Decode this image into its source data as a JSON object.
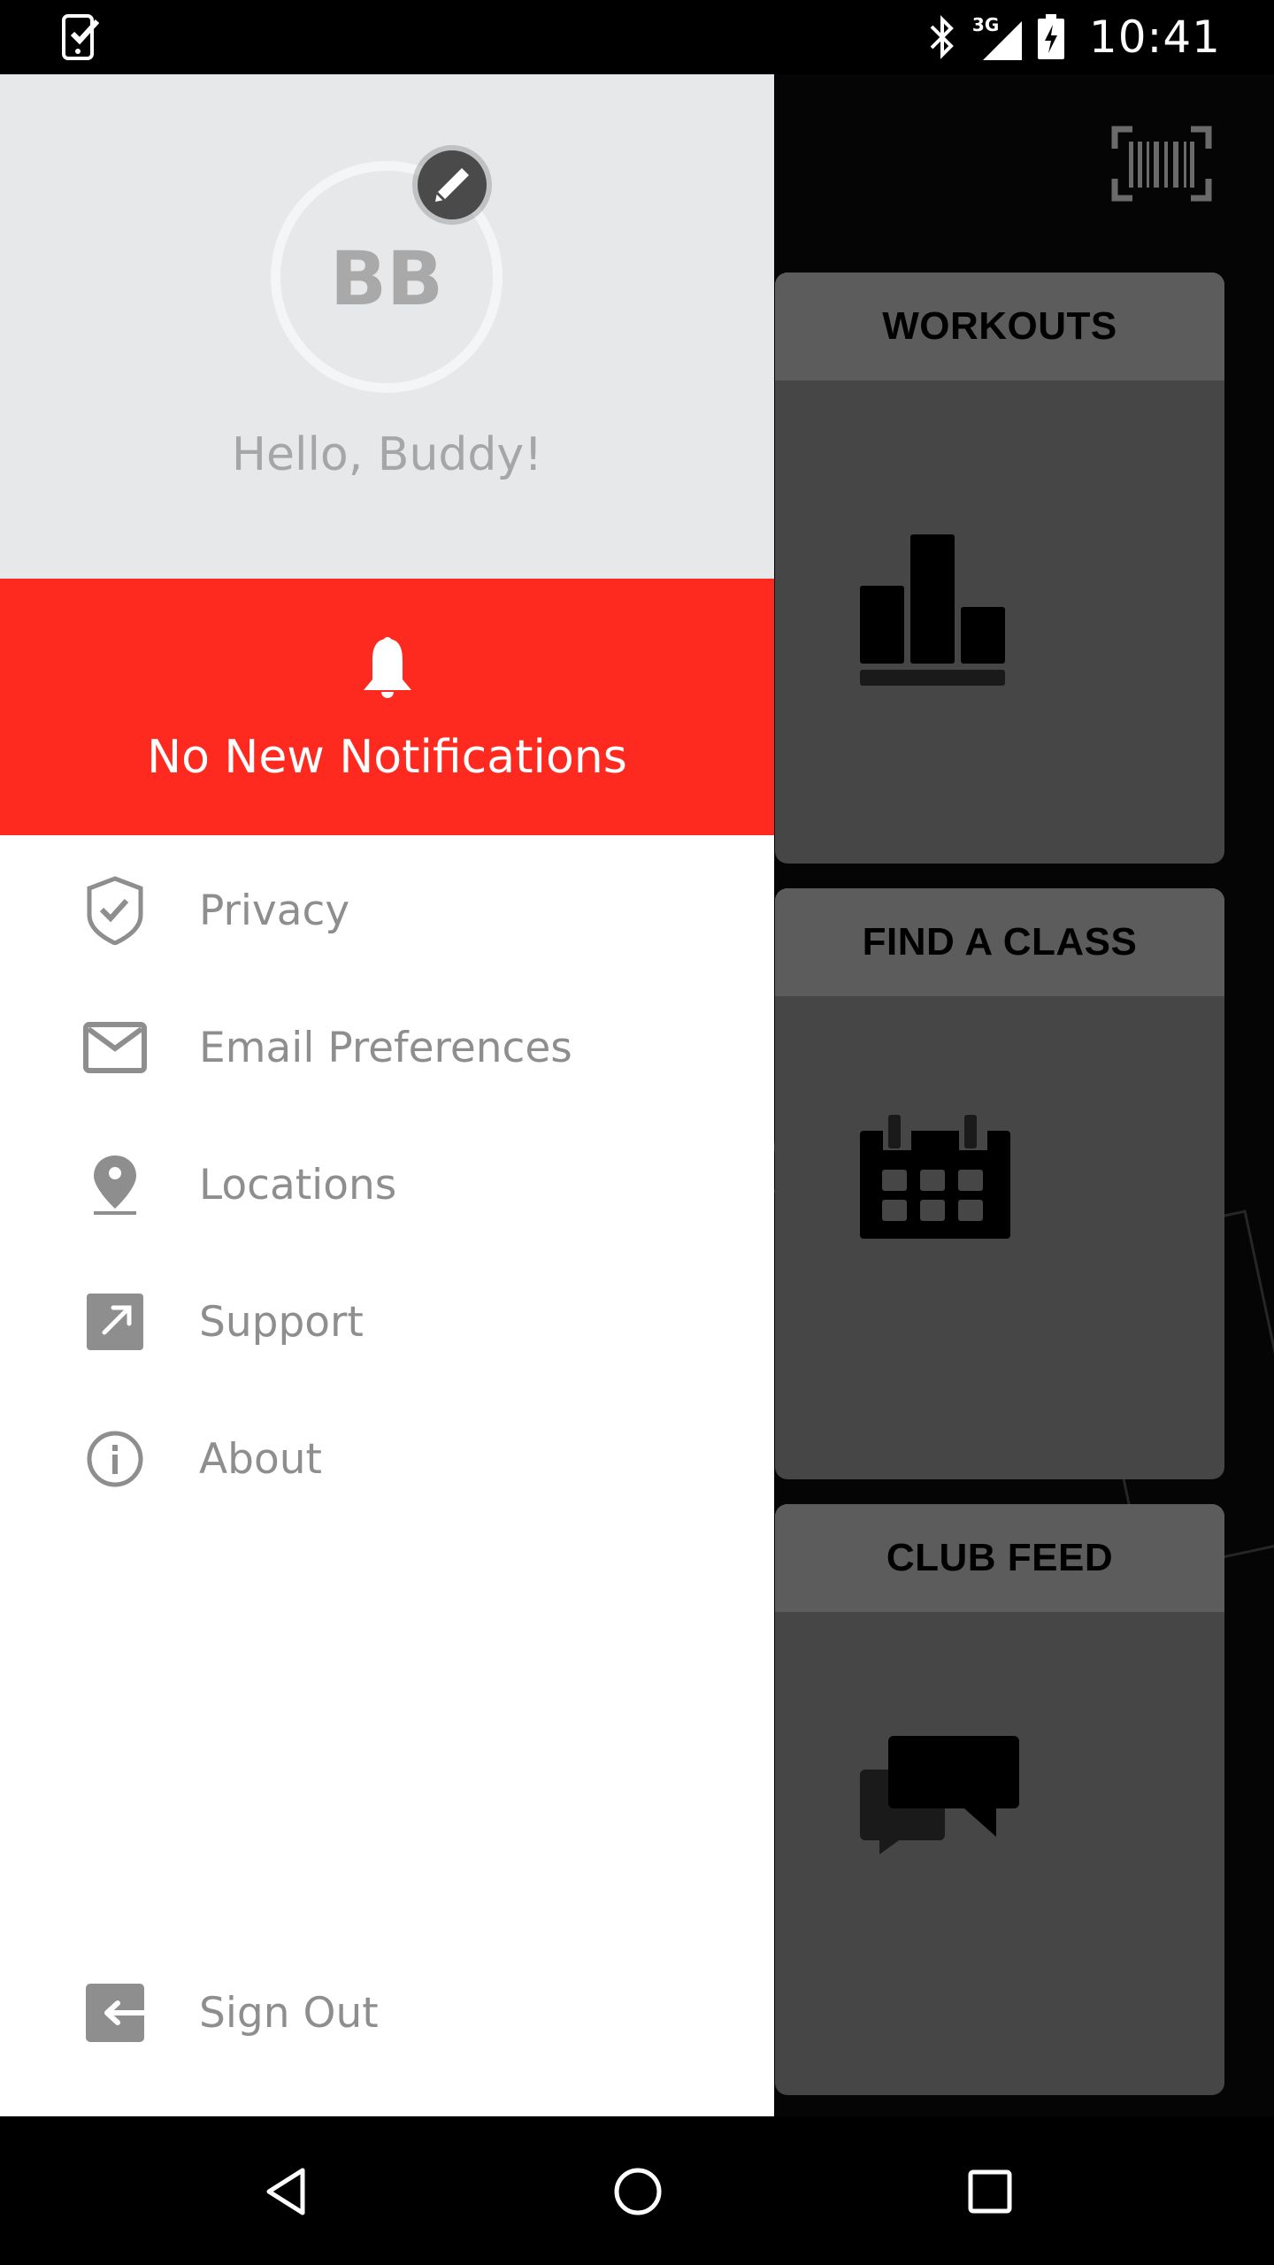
{
  "status_bar": {
    "time": "10:41",
    "network_label": "3G",
    "icons": [
      "task-check-phone-icon",
      "bluetooth-icon",
      "signal-3g-icon",
      "battery-charging-icon"
    ]
  },
  "background_app": {
    "toolbar": {
      "scan_icon": "barcode-scan-icon"
    },
    "tiles": [
      {
        "title": "WORKOUTS",
        "icon": "bar-chart-icon"
      },
      {
        "title": "FIND A CLASS",
        "icon": "calendar-icon"
      },
      {
        "title": "CLUB FEED",
        "icon": "chat-bubbles-icon"
      }
    ]
  },
  "drawer": {
    "profile": {
      "initials": "BB",
      "greeting": "Hello, Buddy!",
      "edit_icon": "pencil-icon"
    },
    "notifications": {
      "text": "No New Notifications",
      "icon": "bell-icon",
      "color": "#ff2a1f"
    },
    "menu": [
      {
        "label": "Privacy",
        "icon": "shield-check-icon"
      },
      {
        "label": "Email Preferences",
        "icon": "envelope-icon"
      },
      {
        "label": "Locations",
        "icon": "location-pin-icon"
      },
      {
        "label": "Support",
        "icon": "external-link-icon"
      },
      {
        "label": "About",
        "icon": "info-icon"
      }
    ],
    "sign_out": {
      "label": "Sign Out",
      "icon": "sign-out-icon"
    }
  },
  "nav_bar": {
    "buttons": [
      "back",
      "home",
      "recents"
    ]
  },
  "colors": {
    "accent_red": "#ff2a1f",
    "drawer_header_bg": "#e7e8ea",
    "menu_text": "#8e8e8e",
    "tile_bg": "#464646",
    "tile_header_bg": "#5c5c5c"
  }
}
